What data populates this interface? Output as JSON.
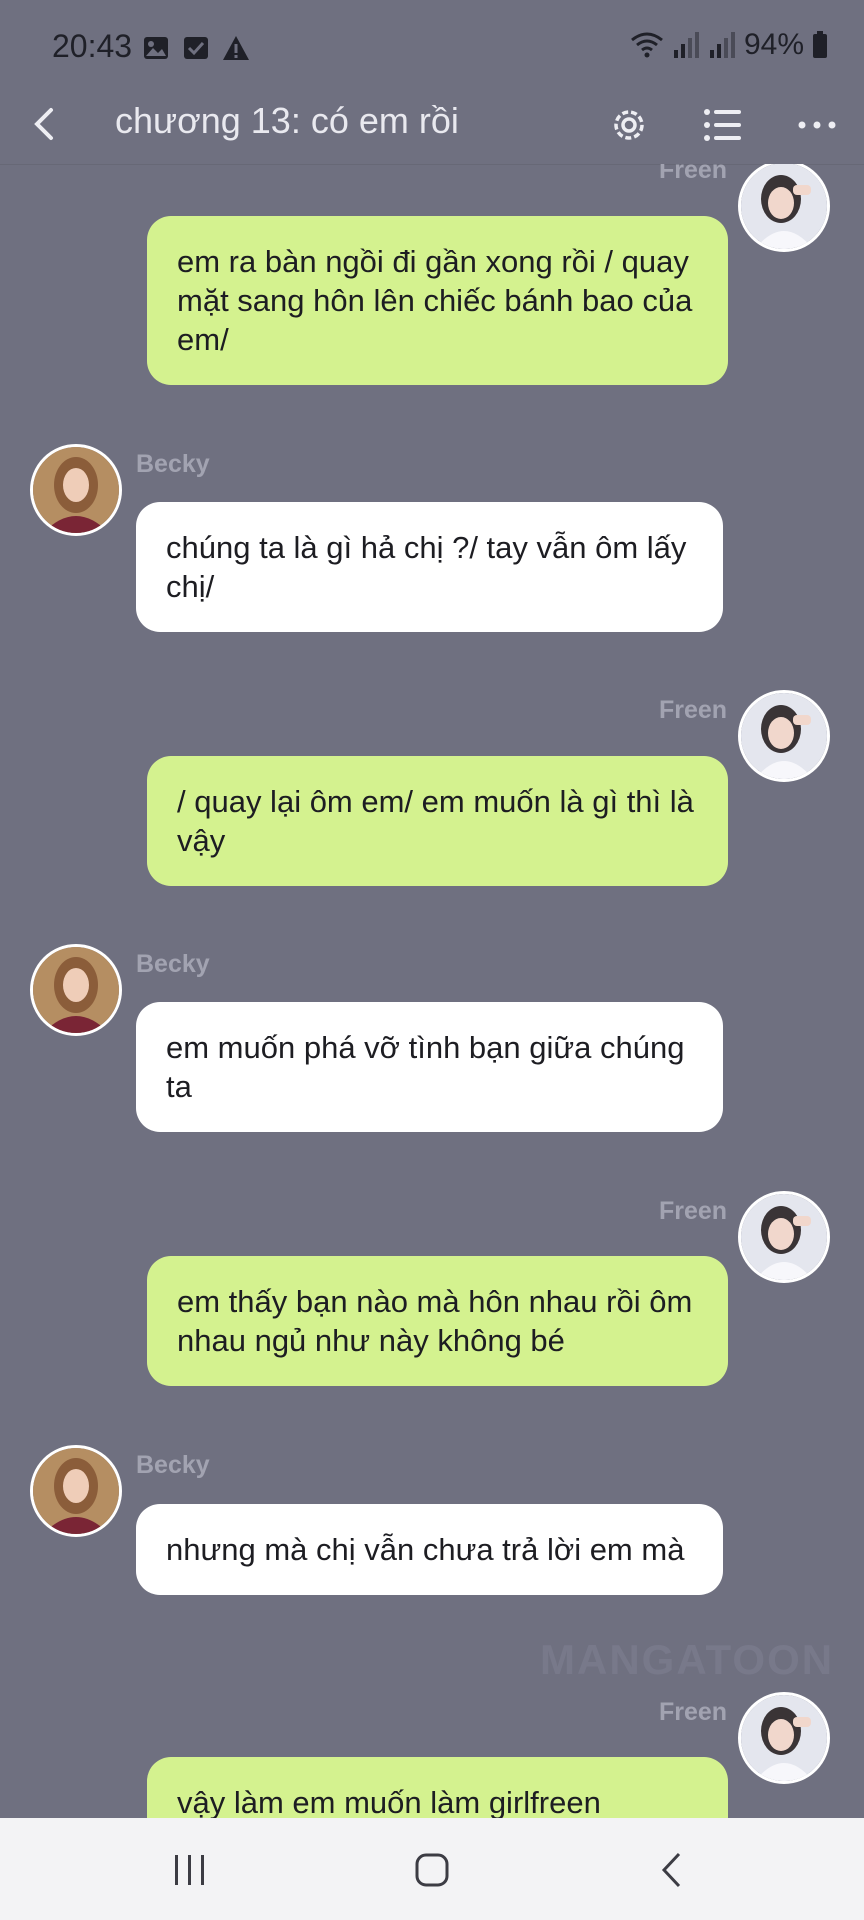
{
  "status_bar": {
    "time": "20:43",
    "battery": "94%",
    "left_icons": [
      "gallery-icon",
      "checkbox-icon",
      "warning-icon"
    ],
    "right_icons": [
      "wifi-icon",
      "signal-icon",
      "signal-icon",
      "battery-icon"
    ]
  },
  "header": {
    "title": "chương 13: có em rồi",
    "buttons": [
      "back-icon",
      "gear-icon",
      "list-icon",
      "more-icon"
    ]
  },
  "colors": {
    "background": "#6f7080",
    "right_bubble": "#d4f28f",
    "left_bubble": "#ffffff",
    "sender_name": "#a2a3b1"
  },
  "messages": [
    {
      "sender": "Freen",
      "side": "right",
      "text": "em ra bàn ngồi đi gần xong rồi / quay mặt sang hôn lên chiếc bánh bao của em/"
    },
    {
      "sender": "Becky",
      "side": "left",
      "text": "chúng ta là gì hả chị ?/ tay vẫn ôm lấy chị/"
    },
    {
      "sender": "Freen",
      "side": "right",
      "text": "/ quay lại ôm em/ em muốn là gì thì là vậy"
    },
    {
      "sender": "Becky",
      "side": "left",
      "text": "em muốn phá vỡ tình bạn giữa chúng ta"
    },
    {
      "sender": "Freen",
      "side": "right",
      "text": "em thấy bạn nào mà hôn nhau rồi ôm nhau ngủ như này không bé"
    },
    {
      "sender": "Becky",
      "side": "left",
      "text": "nhưng mà chị vẫn chưa trả lời em mà"
    },
    {
      "sender": "Freen",
      "side": "right",
      "text": "vậy làm em muốn làm girlfreen"
    }
  ],
  "watermark": "MANGATOON",
  "nav": [
    "recent-apps-icon",
    "home-icon",
    "back-nav-icon"
  ]
}
